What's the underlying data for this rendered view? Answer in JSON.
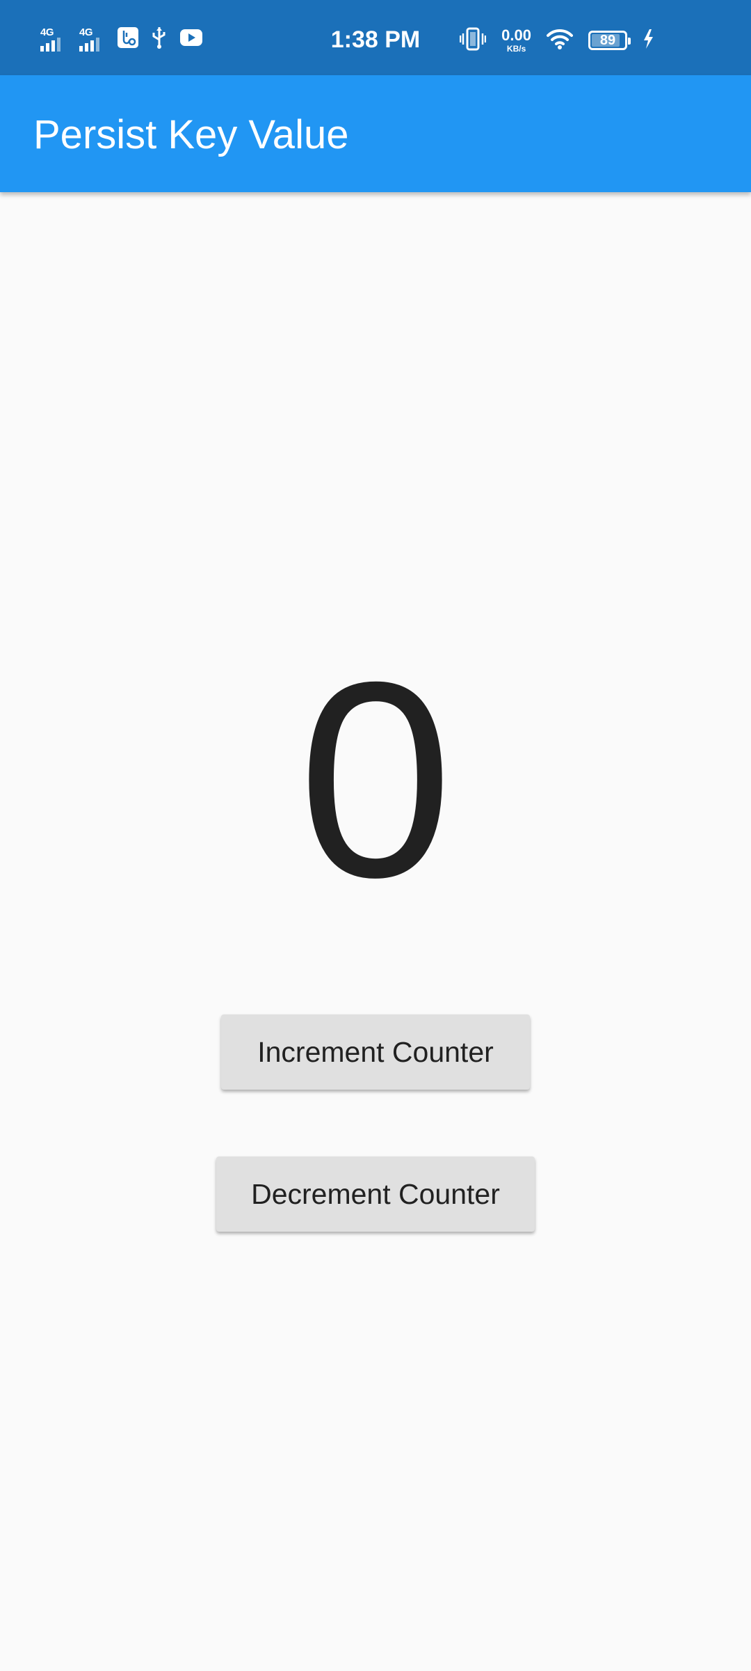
{
  "status_bar": {
    "time": "1:38 PM",
    "network_1": "4G",
    "network_2": "4G",
    "speed_value": "0.00",
    "speed_unit": "KB/s",
    "battery_level": "89",
    "icons_left": [
      "signal-4g-icon",
      "signal-4g-icon",
      "usb-settings-icon",
      "usb-icon",
      "youtube-icon"
    ],
    "icons_right": [
      "vibrate-icon",
      "wifi-icon",
      "battery-icon",
      "charging-icon"
    ]
  },
  "app_bar": {
    "title": "Persist Key Value",
    "color": "#2196f3"
  },
  "counter": {
    "value": "0"
  },
  "buttons": {
    "increment_label": "Increment Counter",
    "decrement_label": "Decrement Counter"
  }
}
